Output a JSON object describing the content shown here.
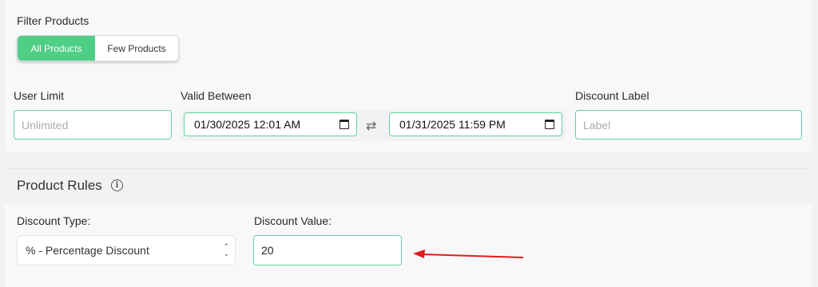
{
  "filter": {
    "label": "Filter Products",
    "options": [
      {
        "label": "All Products",
        "active": true
      },
      {
        "label": "Few Products",
        "active": false
      }
    ],
    "accent_color": "#4fce85"
  },
  "user_limit": {
    "label": "User Limit",
    "value": "",
    "placeholder": "Unlimited"
  },
  "valid_between": {
    "label": "Valid Between",
    "start": "01/30/2025 12:01 AM",
    "end": "01/31/2025 11:59 PM",
    "swap_icon": "swap-arrows-icon"
  },
  "discount_label": {
    "label": "Discount Label",
    "value": "",
    "placeholder": "Label"
  },
  "product_rules": {
    "title": "Product Rules",
    "info_icon": "info-icon",
    "discount_type": {
      "label": "Discount Type:",
      "selected": "% - Percentage Discount"
    },
    "discount_value": {
      "label": "Discount Value:",
      "value": "20"
    },
    "annotation_arrow_color": "#e01b1b"
  }
}
